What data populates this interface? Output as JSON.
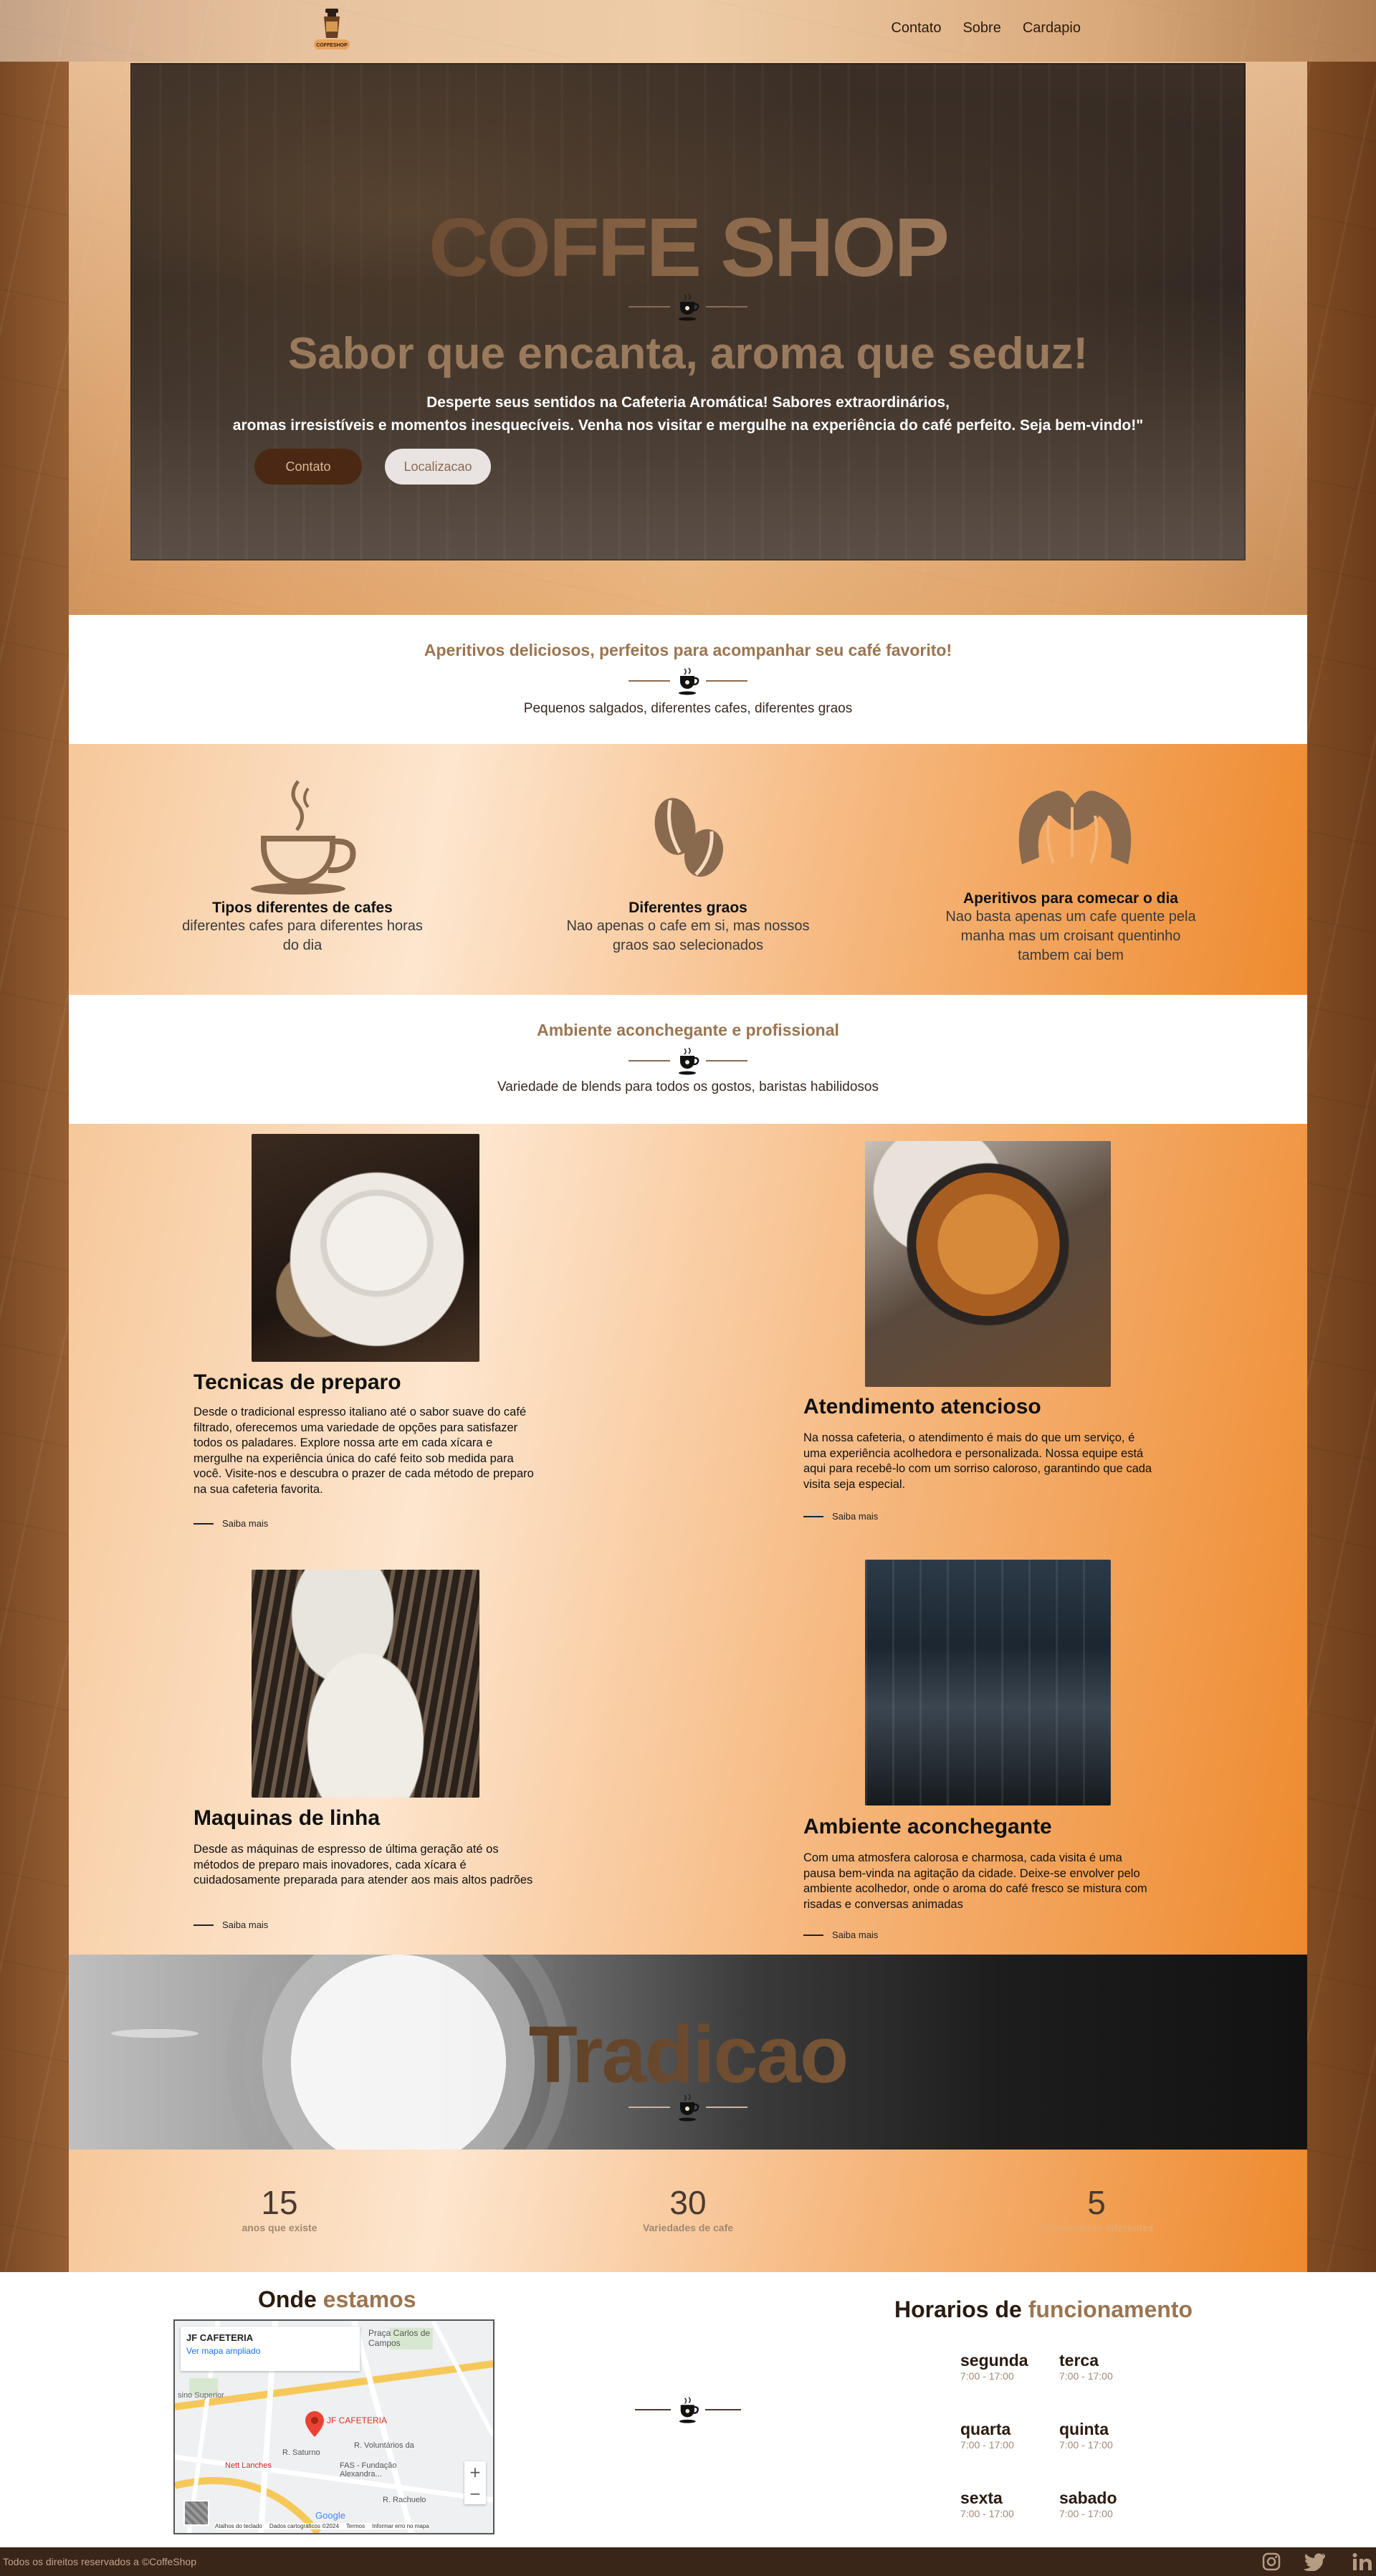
{
  "header": {
    "logo_text": "COFFESHOP",
    "nav": [
      "Contato",
      "Sobre",
      "Cardapio"
    ]
  },
  "hero": {
    "title": "COFFE SHOP",
    "slogan": "Sabor que encanta, aroma que seduz!",
    "desc_line1": "Desperte seus sentidos na Cafeteria Aromática! Sabores extraordinários,",
    "desc_line2": "aromas irresistíveis e momentos inesquecíveis. Venha nos visitar e mergulhe na experiência do café perfeito. Seja bem-vindo!\"",
    "btn_contato": "Contato",
    "btn_local": "Localizacao"
  },
  "aperitivos": {
    "title": "Aperitivos deliciosos, perfeitos para acompanhar seu café favorito!",
    "subtitle": "Pequenos salgados, diferentes cafes, diferentes graos"
  },
  "features": [
    {
      "icon": "coffee-cup-icon",
      "title": "Tipos diferentes de cafes",
      "text": "diferentes cafes para diferentes horas do dia"
    },
    {
      "icon": "coffee-beans-icon",
      "title": "Diferentes graos",
      "text": "Nao apenas o cafe em si, mas nossos graos sao selecionados"
    },
    {
      "icon": "croissant-icon",
      "title": "Aperitivos para comecar o dia",
      "text": "Nao basta apenas um cafe quente pela manha mas um croisant quentinho tambem cai bem"
    }
  ],
  "ambiente": {
    "title": "Ambiente aconchegante e profissional",
    "subtitle": "Variedade de blends para todos os gostos, baristas habilidosos"
  },
  "cards": [
    {
      "title": "Tecnicas de preparo",
      "text": "Desde o tradicional espresso italiano até o sabor suave do café filtrado, oferecemos uma variedade de opções para satisfazer todos os paladares. Explore nossa arte em cada xícara e mergulhe na experiência única do café feito sob medida para você. Visite-nos e descubra o prazer de cada método de preparo na sua cafeteria favorita.",
      "link": "Saiba mais"
    },
    {
      "title": "Atendimento atencioso",
      "text": "Na nossa cafeteria, o atendimento é mais do que um serviço, é uma experiência acolhedora e personalizada. Nossa equipe está aqui para recebê-lo com um sorriso caloroso, garantindo que cada visita seja especial.",
      "link": "Saiba mais"
    },
    {
      "title": "Maquinas de linha",
      "text": "Desde as máquinas de espresso de última geração até os métodos de preparo mais inovadores, cada xícara é cuidadosamente preparada para atender aos mais altos padrões",
      "link": "Saiba mais"
    },
    {
      "title": "Ambiente aconchegante",
      "text": "Com uma atmosfera calorosa e charmosa, cada visita é uma pausa bem-vinda na agitação da cidade. Deixe-se envolver pelo ambiente acolhedor, onde o aroma do café fresco se mistura com risadas e conversas animadas",
      "link": "Saiba mais"
    }
  ],
  "tradicao": {
    "title": "Tradicao"
  },
  "stats": [
    {
      "value": "15",
      "label": "anos que existe"
    },
    {
      "value": "30",
      "label": "Variedades de cafe"
    },
    {
      "value": "5",
      "label": "fornecedores diferentes"
    }
  ],
  "location": {
    "heading_a": "Onde ",
    "heading_b": "estamos",
    "map": {
      "place": "JF CAFETERIA",
      "link": "Ver mapa ampliado",
      "pin_label": "JF CAFETERIA",
      "labels": [
        "Praça Carlos de Campos",
        "R. Saturno",
        "R. Voluntários da",
        "FAS - Fundação Alexandra...",
        "R. Rachuelo",
        "Nett Lanches",
        "sino Superior",
        "Google"
      ],
      "footer": [
        "Atalhos do teclado",
        "Dados cartográficos ©2024",
        "Termos",
        "Informar erro no mapa"
      ]
    }
  },
  "hours": {
    "heading_a": "Horarios de ",
    "heading_b": "funcionamento",
    "days": [
      {
        "day": "segunda",
        "hours": "7:00 - 17:00"
      },
      {
        "day": "terca",
        "hours": "7:00 - 17:00"
      },
      {
        "day": "quarta",
        "hours": "7:00 - 17:00"
      },
      {
        "day": "quinta",
        "hours": "7:00 - 17:00"
      },
      {
        "day": "sexta",
        "hours": "7:00 - 17:00"
      },
      {
        "day": "sabado",
        "hours": "7:00 - 17:00"
      }
    ]
  },
  "footer": {
    "text": "Todos os direitos reservados a ©CoffeShop",
    "social": [
      "instagram-icon",
      "twitter-icon",
      "linkedin-icon"
    ]
  }
}
